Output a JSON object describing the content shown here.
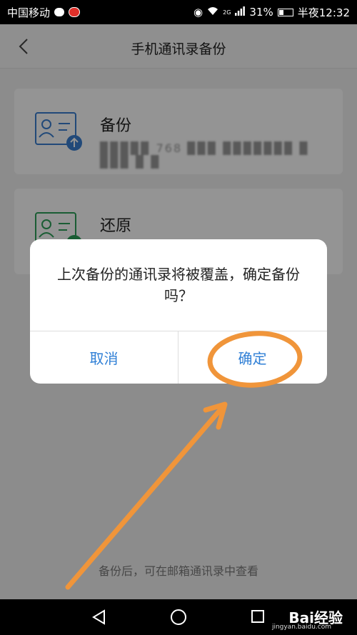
{
  "status_bar": {
    "carrier": "中国移动",
    "network": "2G",
    "battery": "31%",
    "time": "半夜12:32"
  },
  "header": {
    "title": "手机通讯录备份"
  },
  "cards": [
    {
      "title": "备份",
      "subtitle": "▉▉▉▉▉ 768 ▉▉▉ ▉▉▉▉▉▉▉ ▉ ▉▉▉ ▉ ▉"
    },
    {
      "title": "还原"
    }
  ],
  "bottom_note": "备份后，可在邮箱通讯录中查看",
  "dialog": {
    "message": "上次备份的通讯录将被覆盖，确定备份吗？",
    "cancel_label": "取消",
    "confirm_label": "确定"
  },
  "watermark": {
    "brand": "Bai经验",
    "url": "jingyan.baidu.com"
  },
  "colors": {
    "accent": "#2f7fd6",
    "backup_icon": "#3a7fd0",
    "restore_icon": "#2ea05a",
    "annotation": "#f0953a"
  }
}
